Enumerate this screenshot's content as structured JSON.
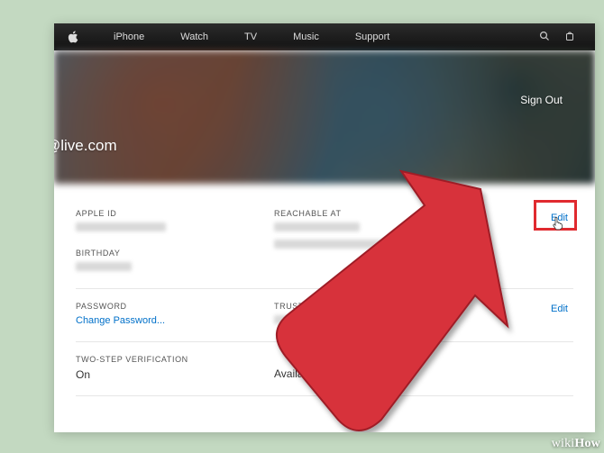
{
  "nav": {
    "items": [
      "iPhone",
      "Watch",
      "TV",
      "Music",
      "Support"
    ]
  },
  "hero": {
    "signout": "Sign Out",
    "email_suffix": "@live.com"
  },
  "section1": {
    "apple_id_label": "APPLE ID",
    "birthday_label": "BIRTHDAY",
    "reachable_label": "REACHABLE AT",
    "edit": "Edit"
  },
  "section2": {
    "password_label": "PASSWORD",
    "change_password": "Change Password...",
    "trusted_label": "TRUSTE",
    "edit": "Edit"
  },
  "section3": {
    "twostep_label": "TWO-STEP VERIFICATION",
    "twostep_value": "On",
    "availability": "Availabl"
  },
  "watermark": {
    "wiki": "wiki",
    "how": "How"
  }
}
